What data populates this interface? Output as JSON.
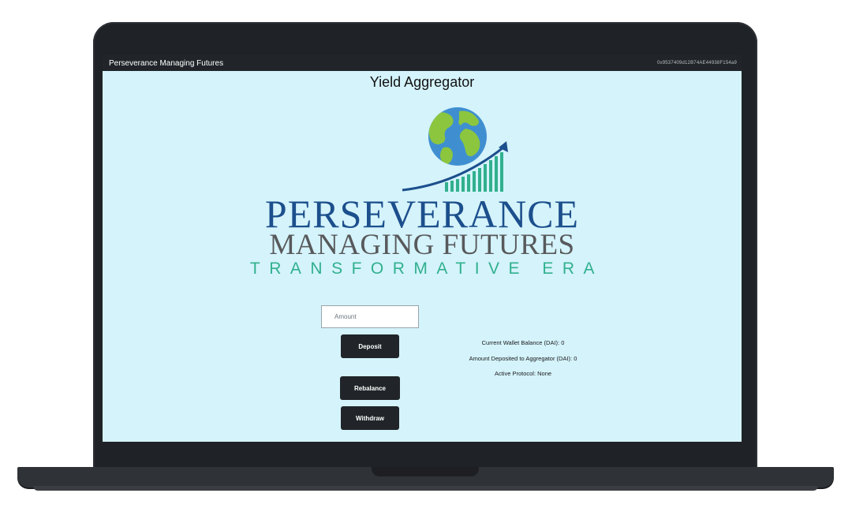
{
  "header": {
    "brand": "Perseverance Managing Futures",
    "wallet_address": "0x9537409d12B74AE44938F154a9"
  },
  "page": {
    "title": "Yield Aggregator"
  },
  "logo": {
    "line1": "PERSEVERANCE",
    "line2": "MANAGING FUTURES",
    "line3": "TRANSFORMATIVE ERA"
  },
  "form": {
    "amount_placeholder": "Amount",
    "amount_value": "",
    "deposit_label": "Deposit",
    "rebalance_label": "Rebalance",
    "withdraw_label": "Withdraw"
  },
  "info": {
    "balance": "Current Wallet Balance (DAI): 0",
    "deposited": "Amount Deposited to Aggregator (DAI): 0",
    "protocol": "Active Protocol: None"
  },
  "colors": {
    "background": "#d4f3fb",
    "header": "#212529",
    "logo_blue": "#1c4f8c",
    "logo_gray": "#58595b",
    "logo_teal": "#31b08e"
  }
}
